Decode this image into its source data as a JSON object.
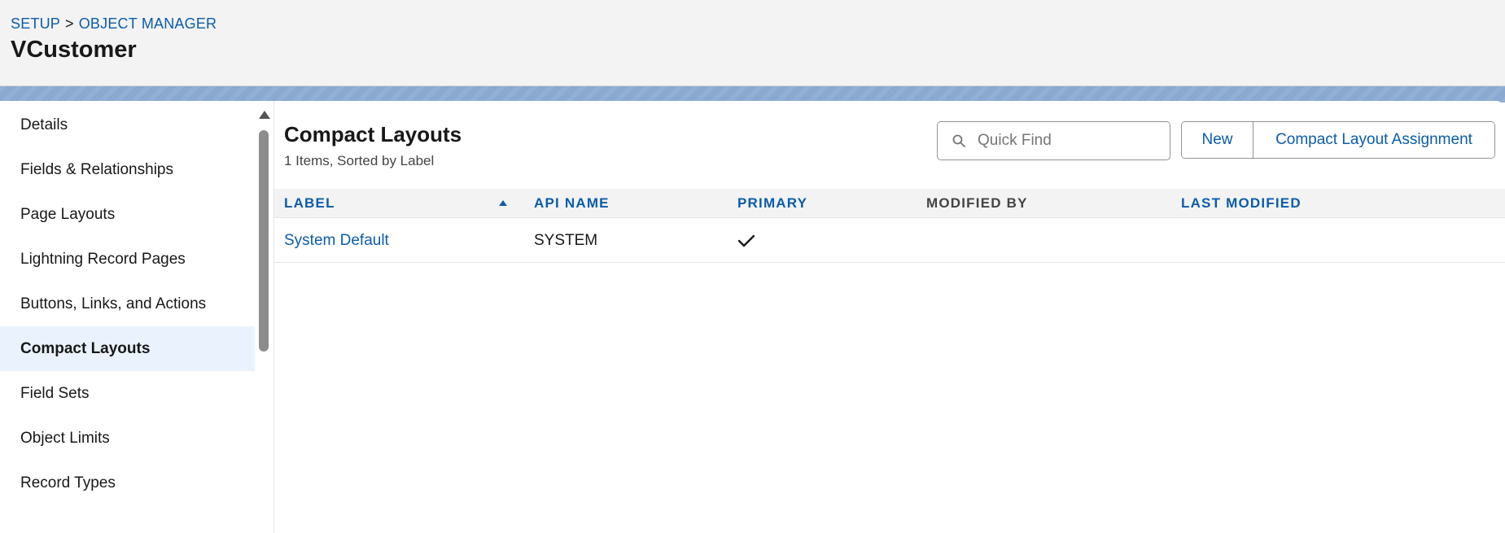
{
  "header": {
    "breadcrumb": {
      "setup": "SETUP",
      "separator": ">",
      "object_manager": "OBJECT MANAGER"
    },
    "title": "VCustomer"
  },
  "sidebar": {
    "items": [
      {
        "label": "Details",
        "active": false
      },
      {
        "label": "Fields & Relationships",
        "active": false
      },
      {
        "label": "Page Layouts",
        "active": false
      },
      {
        "label": "Lightning Record Pages",
        "active": false
      },
      {
        "label": "Buttons, Links, and Actions",
        "active": false
      },
      {
        "label": "Compact Layouts",
        "active": true
      },
      {
        "label": "Field Sets",
        "active": false
      },
      {
        "label": "Object Limits",
        "active": false
      },
      {
        "label": "Record Types",
        "active": false
      }
    ]
  },
  "main": {
    "title": "Compact Layouts",
    "subtitle": "1 Items, Sorted by Label",
    "search": {
      "placeholder": "Quick Find",
      "value": ""
    },
    "buttons": {
      "new_label": "New",
      "assignment_label": "Compact Layout Assignment"
    },
    "table": {
      "columns": [
        "LABEL",
        "API NAME",
        "PRIMARY",
        "MODIFIED BY",
        "LAST MODIFIED"
      ],
      "rows": [
        {
          "label": "System Default",
          "api_name": "SYSTEM",
          "primary": true,
          "modified_by": "",
          "last_modified": ""
        }
      ]
    }
  },
  "colors": {
    "link": "#0b5cab",
    "header_bg": "#f3f3f3",
    "active_nav_bg": "#eaf3fd",
    "banner": "#8aa8d0"
  },
  "icons": {
    "search": "search-icon",
    "sort": "sort-ascending-icon",
    "check": "check-icon"
  }
}
